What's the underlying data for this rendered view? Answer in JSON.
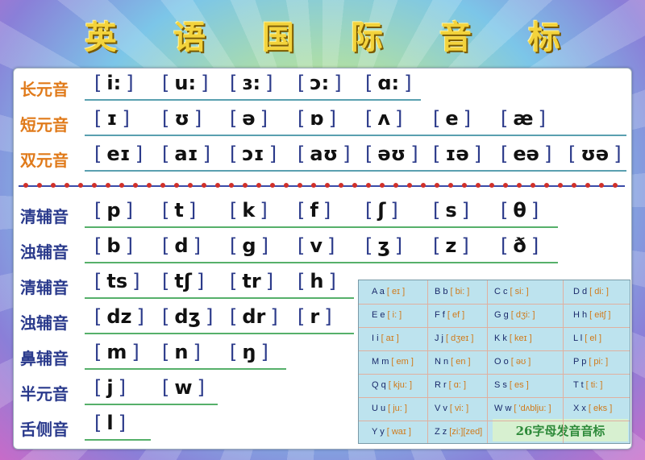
{
  "title": [
    "英",
    "语",
    "国",
    "际",
    "音",
    "标"
  ],
  "rows": [
    {
      "label": "长元音",
      "kind": "vowel",
      "symbols": [
        "i:",
        "u:",
        "ɜ:",
        "ɔ:",
        "ɑ:"
      ]
    },
    {
      "label": "短元音",
      "kind": "vowel",
      "symbols": [
        "ɪ",
        "ʊ",
        "ə",
        "ɒ",
        "ʌ",
        "e",
        "æ"
      ]
    },
    {
      "label": "双元音",
      "kind": "vowel",
      "symbols": [
        "eɪ",
        "aɪ",
        "ɔɪ",
        "aʊ",
        "əʊ",
        "ɪə",
        "eə",
        "ʊə"
      ]
    },
    {
      "label": "清辅音",
      "kind": "cons",
      "symbols": [
        "p",
        "t",
        "k",
        "f",
        "ʃ",
        "s",
        "θ"
      ]
    },
    {
      "label": "浊辅音",
      "kind": "cons",
      "symbols": [
        "b",
        "d",
        "g",
        "v",
        "ʒ",
        "z",
        "ð"
      ]
    },
    {
      "label": "清辅音",
      "kind": "cons",
      "symbols": [
        "ts",
        "tʃ",
        "tr",
        "h"
      ]
    },
    {
      "label": "浊辅音",
      "kind": "cons",
      "symbols": [
        "dz",
        "dʒ",
        "dr",
        "r"
      ]
    },
    {
      "label": "鼻辅音",
      "kind": "cons",
      "symbols": [
        "m",
        "n",
        "ŋ"
      ]
    },
    {
      "label": "半元音",
      "kind": "cons",
      "symbols": [
        "j",
        "w"
      ]
    },
    {
      "label": "舌侧音",
      "kind": "cons",
      "symbols": [
        "l"
      ]
    }
  ],
  "alphabet": [
    {
      "l": "A a",
      "p": "[ eɪ ]"
    },
    {
      "l": "B b",
      "p": "[ bi: ]"
    },
    {
      "l": "C c",
      "p": "[ si: ]"
    },
    {
      "l": "D d",
      "p": "[ di: ]"
    },
    {
      "l": "E e",
      "p": "[ i: ]"
    },
    {
      "l": "F f",
      "p": "[ ef ]"
    },
    {
      "l": "G g",
      "p": "[ dʒi: ]"
    },
    {
      "l": "H h",
      "p": "[ eitʃ ]"
    },
    {
      "l": "I i",
      "p": "[ aɪ ]"
    },
    {
      "l": "J j",
      "p": "[ dʒeɪ ]"
    },
    {
      "l": "K k",
      "p": "[ keɪ ]"
    },
    {
      "l": "L l",
      "p": "[ el ]"
    },
    {
      "l": "M m",
      "p": "[ em ]"
    },
    {
      "l": "N n",
      "p": "[ en ]"
    },
    {
      "l": "O o",
      "p": "[ əʊ ]"
    },
    {
      "l": "P p",
      "p": "[ pi: ]"
    },
    {
      "l": "Q q",
      "p": "[ kju: ]"
    },
    {
      "l": "R r",
      "p": "[ ɑ: ]"
    },
    {
      "l": "S s",
      "p": "[ es ]"
    },
    {
      "l": "T t",
      "p": "[ ti: ]"
    },
    {
      "l": "U u",
      "p": "[ ju: ]"
    },
    {
      "l": "V v",
      "p": "[ vi: ]"
    },
    {
      "l": "W w",
      "p": "[ 'dʌblju: ]"
    },
    {
      "l": "X x",
      "p": "[ eks ]"
    },
    {
      "l": "Y y",
      "p": "[ waɪ ]"
    },
    {
      "l": "Z z",
      "p": "[zi:][zed]"
    }
  ],
  "alphabet_title": "26字母发音音标",
  "colors": {
    "vowel_label": "#e07a1a",
    "cons_label": "#2a3a8c",
    "bracket": "#2b3a8a",
    "phonetic": "#d07a1a"
  }
}
